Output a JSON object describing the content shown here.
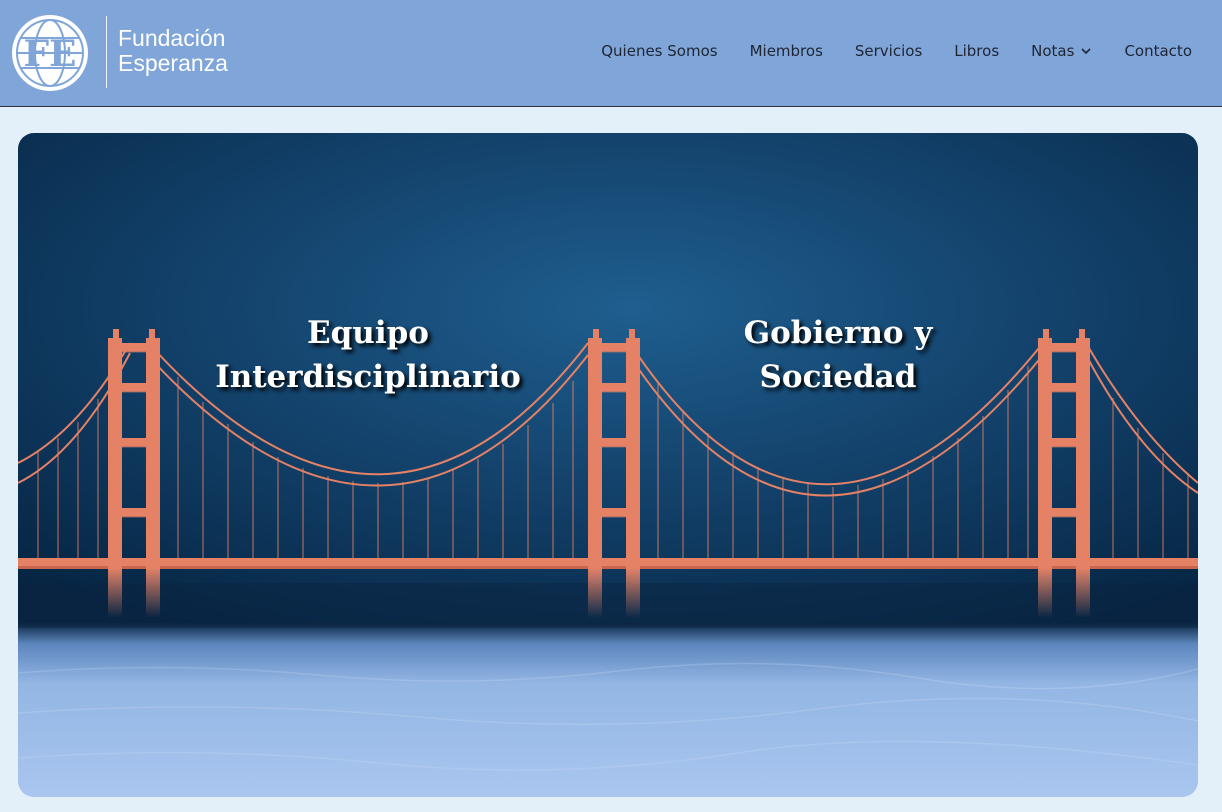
{
  "brand": {
    "logo_monogram": "FE",
    "name_line1": "Fundación",
    "name_line2": "Esperanza"
  },
  "nav": {
    "items": [
      {
        "label": "Quienes Somos"
      },
      {
        "label": "Miembros"
      },
      {
        "label": "Servicios"
      },
      {
        "label": "Libros"
      },
      {
        "label": "Notas",
        "has_dropdown": true
      },
      {
        "label": "Contacto"
      }
    ]
  },
  "hero": {
    "left_title": "Equipo Interdisciplinario",
    "right_title_line1": "Gobierno y",
    "right_title_line2": "Sociedad"
  },
  "colors": {
    "header_bg": "#7fa5d9",
    "page_bg": "#e3eff9",
    "bridge": "#e58266",
    "sky_dark": "#082a48",
    "water": "#9ebde8"
  },
  "icons": {
    "logo": "globe-monogram-icon",
    "dropdown": "chevron-down-icon"
  }
}
